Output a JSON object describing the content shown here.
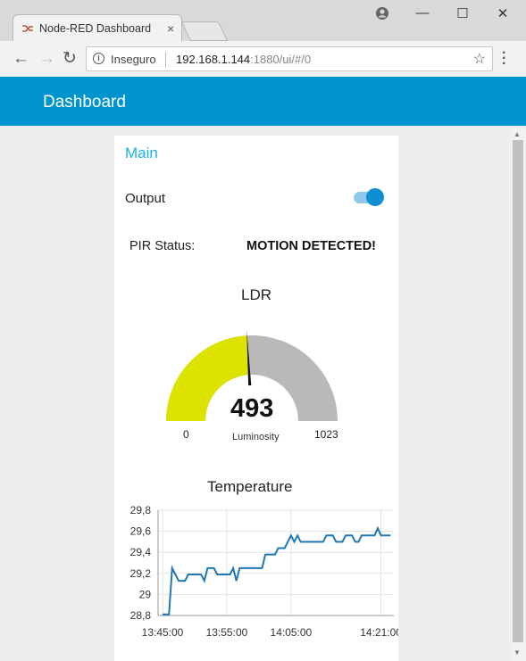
{
  "browser": {
    "tab_title": "Node-RED Dashboard",
    "tab_close": "×",
    "window_buttons": {
      "minimize": "—",
      "maximize": "☐",
      "close": "✕"
    },
    "security_label": "Inseguro",
    "url_host": "192.168.1.144",
    "url_rest": ":1880/ui/#/0",
    "icons": [
      "back-arrow-icon",
      "forward-arrow-icon",
      "reload-icon",
      "info-icon",
      "star-icon",
      "menu-icon",
      "user-icon"
    ]
  },
  "header": {
    "title": "Dashboard",
    "color": "#0094ce"
  },
  "group": {
    "title": "Main"
  },
  "switch": {
    "label": "Output",
    "on": true
  },
  "pir": {
    "label": "PIR Status:",
    "value": "MOTION DETECTED!"
  },
  "gauge": {
    "title": "LDR",
    "value": 493,
    "value_text": "493",
    "units": "Luminosity",
    "min": 0,
    "max": 1023,
    "min_text": "0",
    "max_text": "1023",
    "fill_color": "#dde300",
    "bg_color": "#b9b9b9"
  },
  "chart_data": {
    "type": "line",
    "title": "Temperature",
    "xlabel": "",
    "ylabel": "",
    "ylim": [
      28.8,
      29.8
    ],
    "yticks": [
      "29,8",
      "29,6",
      "29,4",
      "29,2",
      "29",
      "28,8"
    ],
    "xticks": [
      "13:45:00",
      "13:55:00",
      "14:05:00",
      "14:21:00"
    ],
    "color": "#1f77b4",
    "grid": true,
    "x_minutes": [
      0,
      1,
      1.5,
      2,
      2.5,
      3,
      3.5,
      4,
      4.5,
      5,
      5.5,
      6,
      6.5,
      7,
      7.5,
      8,
      8.5,
      9,
      9.5,
      10,
      10.5,
      11,
      11.5,
      12,
      12.5,
      13,
      13.5,
      14,
      14.5,
      15,
      15.5,
      16,
      16.5,
      17,
      17.5,
      18,
      18.5,
      19,
      19.5,
      20,
      20.5,
      21,
      21.5,
      22,
      22.5,
      23,
      23.5,
      24,
      24.5,
      25,
      25.5,
      26,
      26.5,
      27,
      27.5,
      28,
      28.5,
      29,
      29.5,
      30,
      30.5,
      31,
      31.5,
      32,
      32.5,
      33,
      33.5,
      34,
      34.5,
      35,
      35.5
    ],
    "values": [
      28.81,
      28.81,
      29.25,
      29.19,
      29.13,
      29.13,
      29.13,
      29.19,
      29.19,
      29.19,
      29.19,
      29.19,
      29.13,
      29.25,
      29.25,
      29.25,
      29.19,
      29.19,
      29.19,
      29.19,
      29.19,
      29.25,
      29.13,
      29.25,
      29.25,
      29.25,
      29.25,
      29.25,
      29.25,
      29.25,
      29.25,
      29.38,
      29.38,
      29.38,
      29.38,
      29.44,
      29.44,
      29.44,
      29.5,
      29.56,
      29.5,
      29.56,
      29.5,
      29.5,
      29.5,
      29.5,
      29.5,
      29.5,
      29.5,
      29.5,
      29.56,
      29.56,
      29.56,
      29.5,
      29.5,
      29.5,
      29.56,
      29.56,
      29.56,
      29.5,
      29.5,
      29.56,
      29.56,
      29.56,
      29.56,
      29.56,
      29.63,
      29.56,
      29.56,
      29.56,
      29.56
    ]
  }
}
